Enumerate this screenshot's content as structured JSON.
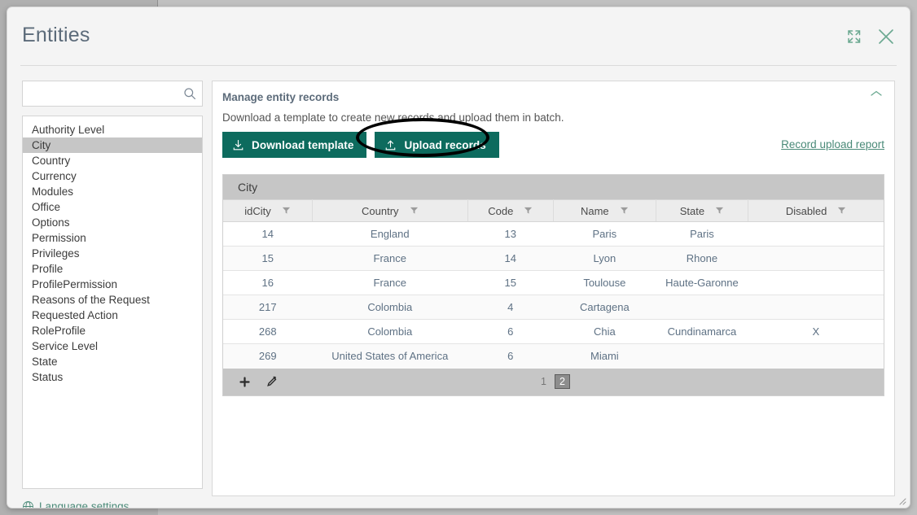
{
  "window": {
    "title": "Entities",
    "expand_icon": "expand-icon",
    "close_icon": "close-icon",
    "resize_grip": "resize-grip-icon"
  },
  "sidebar": {
    "search": {
      "value": "",
      "placeholder": "",
      "icon": "search-icon"
    },
    "items": [
      {
        "label": "Authority Level",
        "selected": false
      },
      {
        "label": "City",
        "selected": true
      },
      {
        "label": "Country",
        "selected": false
      },
      {
        "label": "Currency",
        "selected": false
      },
      {
        "label": "Modules",
        "selected": false
      },
      {
        "label": "Office",
        "selected": false
      },
      {
        "label": "Options",
        "selected": false
      },
      {
        "label": "Permission",
        "selected": false
      },
      {
        "label": "Privileges",
        "selected": false
      },
      {
        "label": "Profile",
        "selected": false
      },
      {
        "label": "ProfilePermission",
        "selected": false
      },
      {
        "label": "Reasons of the Request",
        "selected": false
      },
      {
        "label": "Requested Action",
        "selected": false
      },
      {
        "label": "RoleProfile",
        "selected": false
      },
      {
        "label": "Service Level",
        "selected": false
      },
      {
        "label": "State",
        "selected": false
      },
      {
        "label": "Status",
        "selected": false
      }
    ],
    "language_settings": {
      "label": "Language settings",
      "icon": "globe-icon"
    }
  },
  "panel": {
    "title": "Manage entity records",
    "description": "Download a template to create new records and upload them in batch.",
    "collapse_icon": "chevron-up-icon",
    "download_button": {
      "label": "Download template",
      "icon": "download-icon"
    },
    "upload_button": {
      "label": "Upload records",
      "icon": "upload-icon",
      "highlighted": true
    },
    "report_link": "Record upload report"
  },
  "table": {
    "caption": "City",
    "columns": [
      {
        "label": "idCity",
        "filter_icon": "filter-icon"
      },
      {
        "label": "Country",
        "filter_icon": "filter-icon"
      },
      {
        "label": "Code",
        "filter_icon": "filter-icon"
      },
      {
        "label": "Name",
        "filter_icon": "filter-icon"
      },
      {
        "label": "State",
        "filter_icon": "filter-icon"
      },
      {
        "label": "Disabled",
        "filter_icon": "filter-icon"
      }
    ],
    "rows": [
      [
        "14",
        "England",
        "13",
        "Paris",
        "Paris",
        ""
      ],
      [
        "15",
        "France",
        "14",
        "Lyon",
        "Rhone",
        ""
      ],
      [
        "16",
        "France",
        "15",
        "Toulouse",
        "Haute-Garonne",
        ""
      ],
      [
        "217",
        "Colombia",
        "4",
        "Cartagena",
        "",
        ""
      ],
      [
        "268",
        "Colombia",
        "6",
        "Chia",
        "Cundinamarca",
        "X"
      ],
      [
        "269",
        "United States of America",
        "6",
        "Miami",
        "",
        ""
      ]
    ],
    "footer": {
      "add_icon": "plus-icon",
      "edit_icon": "pencil-icon",
      "pages": [
        {
          "label": "1",
          "active": false
        },
        {
          "label": "2",
          "active": true
        }
      ]
    }
  },
  "colors": {
    "accent_green": "#0d6b5e",
    "link_green": "#4a8a78",
    "title_slate": "#5c6b7a",
    "selected_row": "#c6c6c6"
  }
}
